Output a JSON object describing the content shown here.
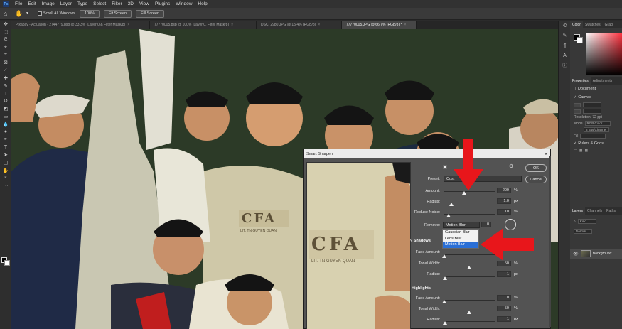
{
  "menu": {
    "logo": "Ps",
    "items": [
      "File",
      "Edit",
      "Image",
      "Layer",
      "Type",
      "Select",
      "Filter",
      "3D",
      "View",
      "Plugins",
      "Window",
      "Help"
    ]
  },
  "options_bar": {
    "scroll_all": "Scroll All Windows",
    "zoom_100": "100%",
    "fit_screen": "Fit Screen",
    "fill_screen": "Fill Screen"
  },
  "tabs": [
    {
      "label": "Pixabay - Actuation - 2744779.psb @ 33.3% (Layer 0 & Filter Mask/8)",
      "active": false
    },
    {
      "label": "77770005.psb @ 100% (Layer 0, Filter Mask/8)",
      "active": false
    },
    {
      "label": "DSC_2980.JPG @ 15.4% (RGB/8)",
      "active": false
    },
    {
      "label": "77770005.JPG @ 66.7% (RGB/8) *",
      "active": true
    }
  ],
  "right_panel": {
    "color_tabs": [
      "Color",
      "Swatches",
      "Gradi"
    ],
    "prop_tabs": [
      "Properties",
      "Adjustments"
    ],
    "document_label": "Document",
    "canvas_label": "Canvas",
    "resolution": "Resolution: 72 ppi",
    "mode_label": "Mode",
    "mode_value": "RGB Color",
    "bits_value": "8 Bits/Channel",
    "fill_label": "Fill",
    "rulers_label": "Rulers & Grids",
    "layers_tabs": [
      "Layers",
      "Channels",
      "Paths"
    ],
    "kind_label": "Kind",
    "normal_label": "Normal",
    "layer_name": "Background"
  },
  "dialog": {
    "title": "Smart Sharpen",
    "ok": "OK",
    "cancel": "Cancel",
    "preset_label": "Preset:",
    "preset_value": "Cust",
    "amount_label": "Amount:",
    "amount_value": "200",
    "amount_unit": "%",
    "amount_level": 0.4,
    "radius_label": "Radius:",
    "radius_value": "1.0",
    "radius_unit": "px",
    "radius_level": 0.15,
    "reduce_noise_label": "Reduce Noise:",
    "reduce_noise_value": "10",
    "reduce_noise_unit": "%",
    "reduce_noise_level": 0.1,
    "remove_label": "Remove:",
    "remove_value": "Motion Blur",
    "angle_value": "0",
    "remove_options": [
      "Gaussian Blur",
      "Lens Blur",
      "Motion Blur"
    ],
    "shadows_label": "Shadows",
    "shadows_fade_label": "Fade Amount:",
    "shadows_fade_value": "0",
    "shadows_fade_unit": "%",
    "shadows_tonal_label": "Tonal Width:",
    "shadows_tonal_value": "50",
    "shadows_tonal_unit": "%",
    "shadows_radius_label": "Radius:",
    "shadows_radius_value": "1",
    "shadows_radius_unit": "px",
    "highlights_label": "Highlights",
    "hl_fade_label": "Fade Amount:",
    "hl_fade_value": "0",
    "hl_fade_unit": "%",
    "hl_tonal_label": "Tonal Width:",
    "hl_tonal_value": "50",
    "hl_tonal_unit": "%",
    "hl_radius_label": "Radius:",
    "hl_radius_value": "1",
    "hl_radius_unit": "px",
    "preview_text_1": "CFA",
    "preview_text_2": "LIT. TN GUYEN QUAN"
  },
  "canvas_shirt_text": "CFA",
  "canvas_shirt_sub": "LIT. TN GUYEN QUAN",
  "colors": {
    "accent_red": "#e8161b",
    "selected_blue": "#2a6fd6",
    "dialog_bg": "#535353"
  }
}
